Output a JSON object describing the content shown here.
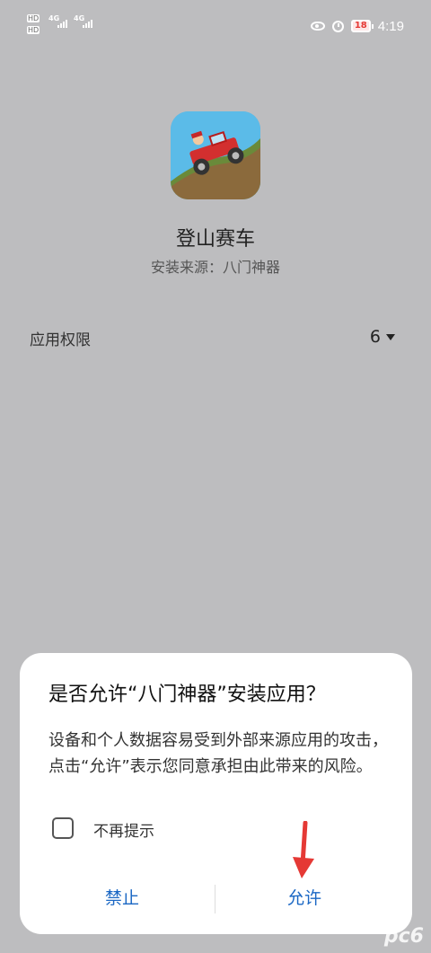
{
  "status_bar": {
    "sim1_hd": "HD",
    "sim1_net": "4G",
    "sim2_hd": "HD",
    "sim2_net": "4G",
    "battery": "18",
    "time": "4:19",
    "icons": [
      "eye-icon",
      "alarm-icon",
      "battery-icon"
    ]
  },
  "app": {
    "name": "登山赛车",
    "source": "安装来源：八门神器",
    "icon": "hill-climb-racing-app-icon"
  },
  "permissions": {
    "label": "应用权限",
    "count": "6"
  },
  "dialog": {
    "title": "是否允许“八门神器”安装应用？",
    "body": "设备和个人数据容易受到外部来源应用的攻击，点击“允许”表示您同意承担由此带来的风险。",
    "checkbox_label": "不再提示",
    "checkbox_checked": false,
    "deny_label": "禁止",
    "allow_label": "允许",
    "accent_color": "#1a67c4"
  },
  "annotation": {
    "arrow_color": "#e53935"
  },
  "watermark": "pc6"
}
